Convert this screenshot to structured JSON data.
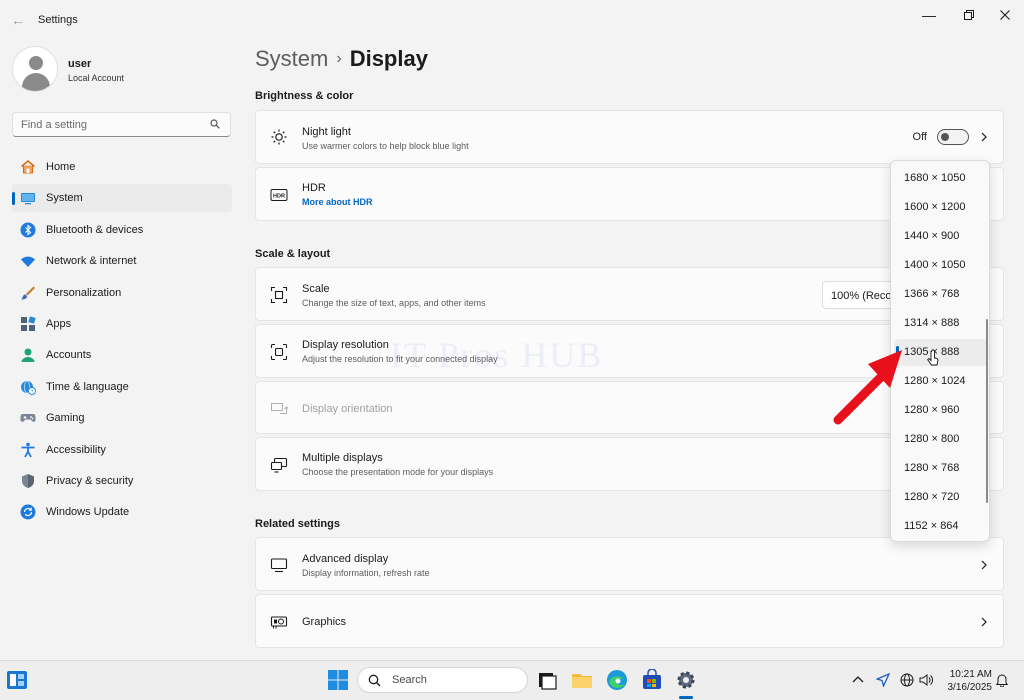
{
  "window": {
    "title": "Settings"
  },
  "user": {
    "name": "user",
    "account_type": "Local Account"
  },
  "search": {
    "placeholder": "Find a setting"
  },
  "nav": {
    "items": [
      {
        "label": "Home",
        "icon": "home-icon"
      },
      {
        "label": "System",
        "icon": "system-icon",
        "active": true
      },
      {
        "label": "Bluetooth & devices",
        "icon": "bluetooth-icon"
      },
      {
        "label": "Network & internet",
        "icon": "wifi-icon"
      },
      {
        "label": "Personalization",
        "icon": "brush-icon"
      },
      {
        "label": "Apps",
        "icon": "apps-icon"
      },
      {
        "label": "Accounts",
        "icon": "accounts-icon"
      },
      {
        "label": "Time & language",
        "icon": "globe-clock-icon"
      },
      {
        "label": "Gaming",
        "icon": "gamepad-icon"
      },
      {
        "label": "Accessibility",
        "icon": "accessibility-icon"
      },
      {
        "label": "Privacy & security",
        "icon": "shield-icon"
      },
      {
        "label": "Windows Update",
        "icon": "update-icon"
      }
    ]
  },
  "breadcrumb": {
    "parent": "System",
    "separator": "›",
    "current": "Display"
  },
  "sections": {
    "brightness": "Brightness & color",
    "scale_layout": "Scale & layout",
    "related": "Related settings"
  },
  "cards": {
    "night_light": {
      "title": "Night light",
      "subtitle": "Use warmer colors to help block blue light",
      "state": "Off"
    },
    "hdr": {
      "title": "HDR",
      "link": "More about HDR"
    },
    "scale": {
      "title": "Scale",
      "subtitle": "Change the size of text, apps, and other items",
      "value": "100% (Recommended)"
    },
    "resolution": {
      "title": "Display resolution",
      "subtitle": "Adjust the resolution to fit your connected display"
    },
    "orientation": {
      "title": "Display orientation"
    },
    "multiple": {
      "title": "Multiple displays",
      "subtitle": "Choose the presentation mode for your displays"
    },
    "advanced": {
      "title": "Advanced display",
      "subtitle": "Display information, refresh rate"
    },
    "graphics": {
      "title": "Graphics"
    }
  },
  "resolution_dropdown": {
    "options": [
      "1680 × 1050",
      "1600 × 1200",
      "1440 × 900",
      "1400 × 1050",
      "1366 × 768",
      "1314 × 888",
      "1305 × 888",
      "1280 × 1024",
      "1280 × 960",
      "1280 × 800",
      "1280 × 768",
      "1280 × 720",
      "1152 × 864"
    ],
    "selected": "1305 × 888"
  },
  "watermark": "IT Pros HUB",
  "taskbar": {
    "search_label": "Search",
    "time": "10:21 AM",
    "date": "3/16/2025"
  },
  "colors": {
    "accent": "#0067c0",
    "arrow": "#e8101a"
  }
}
